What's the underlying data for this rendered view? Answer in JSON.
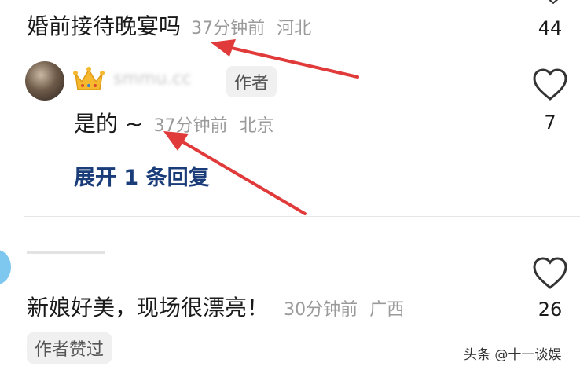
{
  "comments": [
    {
      "text": "婚前接待晚宴吗",
      "time": "37分钟前",
      "location": "河北",
      "likes": "44"
    },
    {
      "username": "smmu.cc",
      "author_badge": "作者",
      "text": "是的 ~",
      "time": "37分钟前",
      "location": "北京",
      "likes": "7",
      "expand_label": "展开 1 条回复"
    },
    {
      "text": "新娘好美，现场很漂亮！",
      "time": "30分钟前",
      "location": "广西",
      "likes": "26",
      "author_liked_badge": "作者赞过"
    }
  ],
  "watermark": "头条 @十一谈娱",
  "colors": {
    "link": "#1a3d7a",
    "arrow": "#e03a3a",
    "meta": "#9a9a9a"
  }
}
